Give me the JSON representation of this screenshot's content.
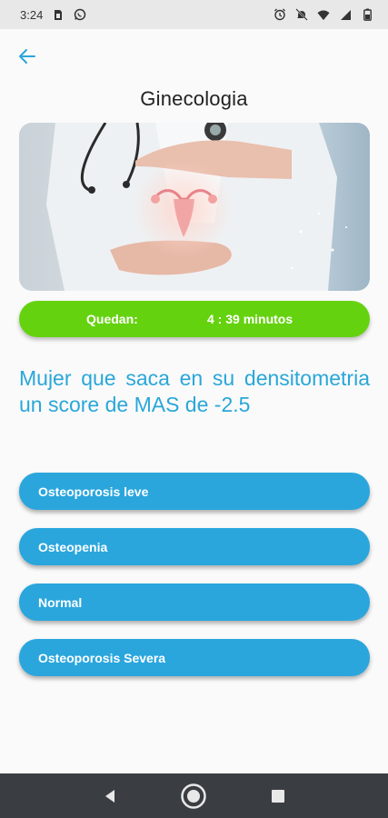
{
  "status_bar": {
    "time": "3:24"
  },
  "header": {
    "title": "Ginecologia"
  },
  "timer": {
    "label": "Quedan:",
    "value": "4 : 39 minutos",
    "color": "#65d20f"
  },
  "question": {
    "text": "Mujer que saca en su densitometria un score de MAS de -2.5"
  },
  "answers": [
    {
      "label": "Osteoporosis leve"
    },
    {
      "label": "Osteopenia"
    },
    {
      "label": "Normal"
    },
    {
      "label": "Osteoporosis Severa"
    }
  ],
  "theme": {
    "accent": "#2aa6dd",
    "question_color": "#29a7d9"
  }
}
